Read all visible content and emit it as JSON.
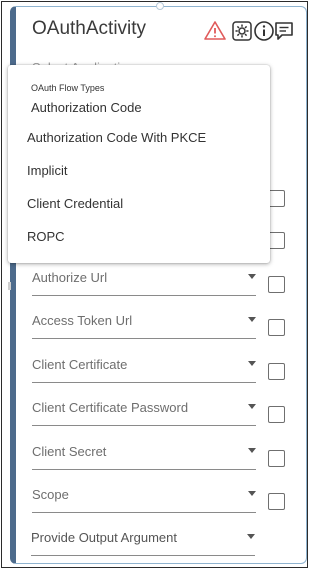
{
  "activity": {
    "title": "OAuthActivity",
    "icons": [
      "warning-icon",
      "gear-icon",
      "info-icon",
      "comment-icon"
    ],
    "accent_color": "#4d6b8c",
    "warning_color": "#e05a5a"
  },
  "select_application": {
    "placeholder": "Select Application"
  },
  "flow_popup": {
    "group_label": "OAuth Flow Types",
    "options": [
      "Authorization Code",
      "Authorization Code With PKCE",
      "Implicit",
      "Client Credential",
      "ROPC"
    ]
  },
  "fields": [
    {
      "label": "Authorize Url"
    },
    {
      "label": "Access Token Url"
    },
    {
      "label": "Client Certificate"
    },
    {
      "label": "Client Certificate Password"
    },
    {
      "label": "Client Secret"
    },
    {
      "label": "Scope"
    },
    {
      "label": "Provide Output Argument"
    }
  ]
}
